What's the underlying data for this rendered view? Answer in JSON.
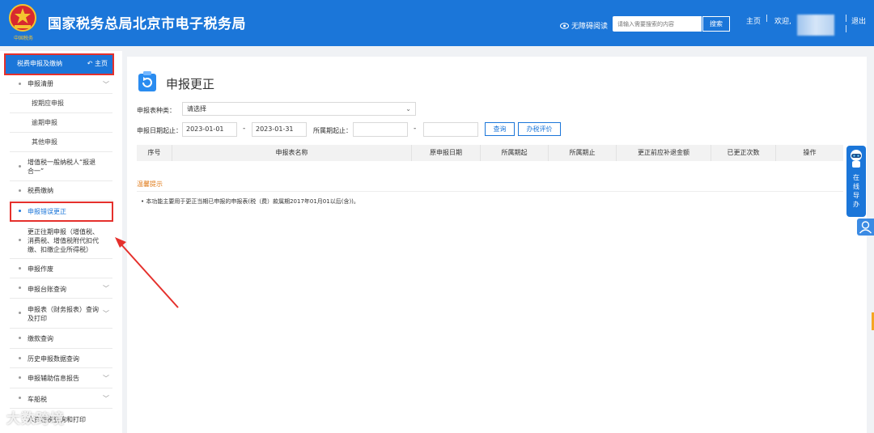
{
  "header": {
    "title": "国家税务总局北京市电子税务局",
    "emblem_caption": "中国税务",
    "accessibility": "无障碍阅读",
    "search_placeholder": "请输入需要搜索的内容",
    "search_button": "搜索",
    "home": "主页",
    "separator": "|",
    "welcome": "欢迎,",
    "logout": "退出"
  },
  "sidebar": {
    "section": "税费申报及缴纳",
    "home_link": "主页",
    "items": [
      {
        "label": "申报清册"
      },
      {
        "label": "按期应申报"
      },
      {
        "label": "逾期申报"
      },
      {
        "label": "其他申报"
      },
      {
        "label": "增值税一般纳税人“报退合一”"
      },
      {
        "label": "税费缴纳"
      },
      {
        "label": "申报错误更正"
      },
      {
        "label": "更正往期申报（增值税、消费税、增值税附代扣代缴、扣缴企业所得税）"
      },
      {
        "label": "申报作废"
      },
      {
        "label": "申报台账查询"
      },
      {
        "label": "申报表（财务报表）查询及打印"
      },
      {
        "label": "缴款查询"
      },
      {
        "label": "历史申报数据查询"
      },
      {
        "label": "申报辅助信息报告"
      },
      {
        "label": "车船税"
      },
      {
        "label": "水资源税查询和打印"
      }
    ]
  },
  "main": {
    "title": "申报更正",
    "form": {
      "type_label": "申报表种类：",
      "type_value": "请选择",
      "date_label": "申报日期起止：",
      "date_from": "2023-01-01",
      "date_to": "2023-01-31",
      "dash": "-",
      "period_label": "所属期起止：",
      "period_from": "",
      "period_to": "",
      "query_button": "查询",
      "evaluate_button": "办税评价"
    },
    "table_headers": [
      "序号",
      "申报表名称",
      "原申报日期",
      "所属期起",
      "所属期止",
      "更正前应补退金额",
      "已更正次数",
      "操作"
    ],
    "tip_title": "温馨提示",
    "tip_text": "本功能主要用于更正当期已申报的申报表(税（费）款属期2017年01月01以后(含))。"
  },
  "float_guide": {
    "text": "在线导办"
  },
  "watermark": "大数跨境",
  "colors": {
    "primary": "#1b76d9",
    "highlight": "#e5302c",
    "tip": "#e07b1a"
  }
}
